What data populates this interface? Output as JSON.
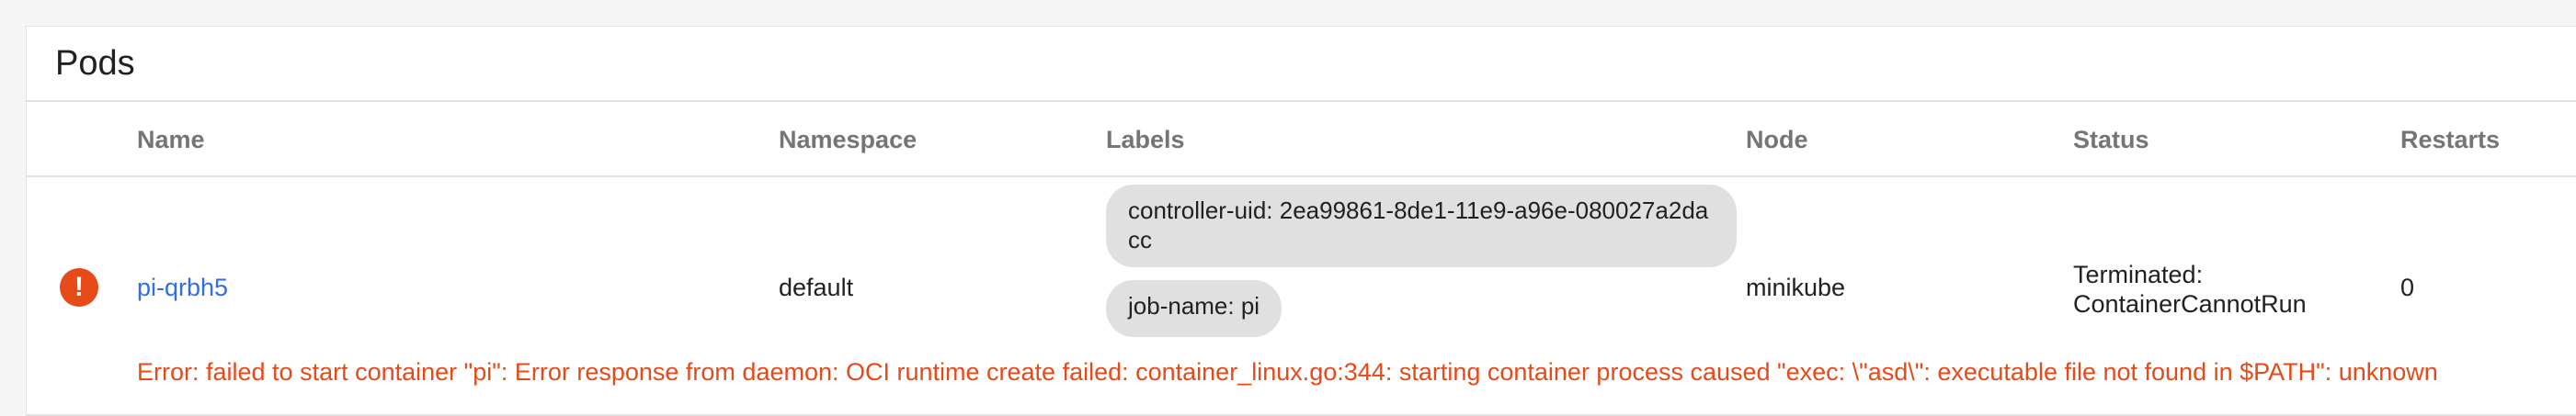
{
  "card": {
    "title": "Pods"
  },
  "table": {
    "headers": {
      "name": "Name",
      "namespace": "Namespace",
      "labels": "Labels",
      "node": "Node",
      "status": "Status",
      "restarts": "Restarts"
    },
    "rows": [
      {
        "status_icon": "error-icon",
        "name": "pi-qrbh5",
        "namespace": "default",
        "labels": [
          "controller-uid: 2ea99861-8de1-11e9-a96e-080027a2dacc",
          "job-name: pi"
        ],
        "node": "minikube",
        "status": "Terminated: ContainerCannotRun",
        "restarts": "0",
        "error": "Error: failed to start container \"pi\": Error response from daemon: OCI runtime create failed: container_linux.go:344: starting container process caused \"exec: \\\"asd\\\": executable file not found in $PATH\": unknown"
      }
    ]
  },
  "colors": {
    "error": "#e64a19",
    "link": "#326de6",
    "chip": "#e0e0e0",
    "header_text": "#757575"
  }
}
